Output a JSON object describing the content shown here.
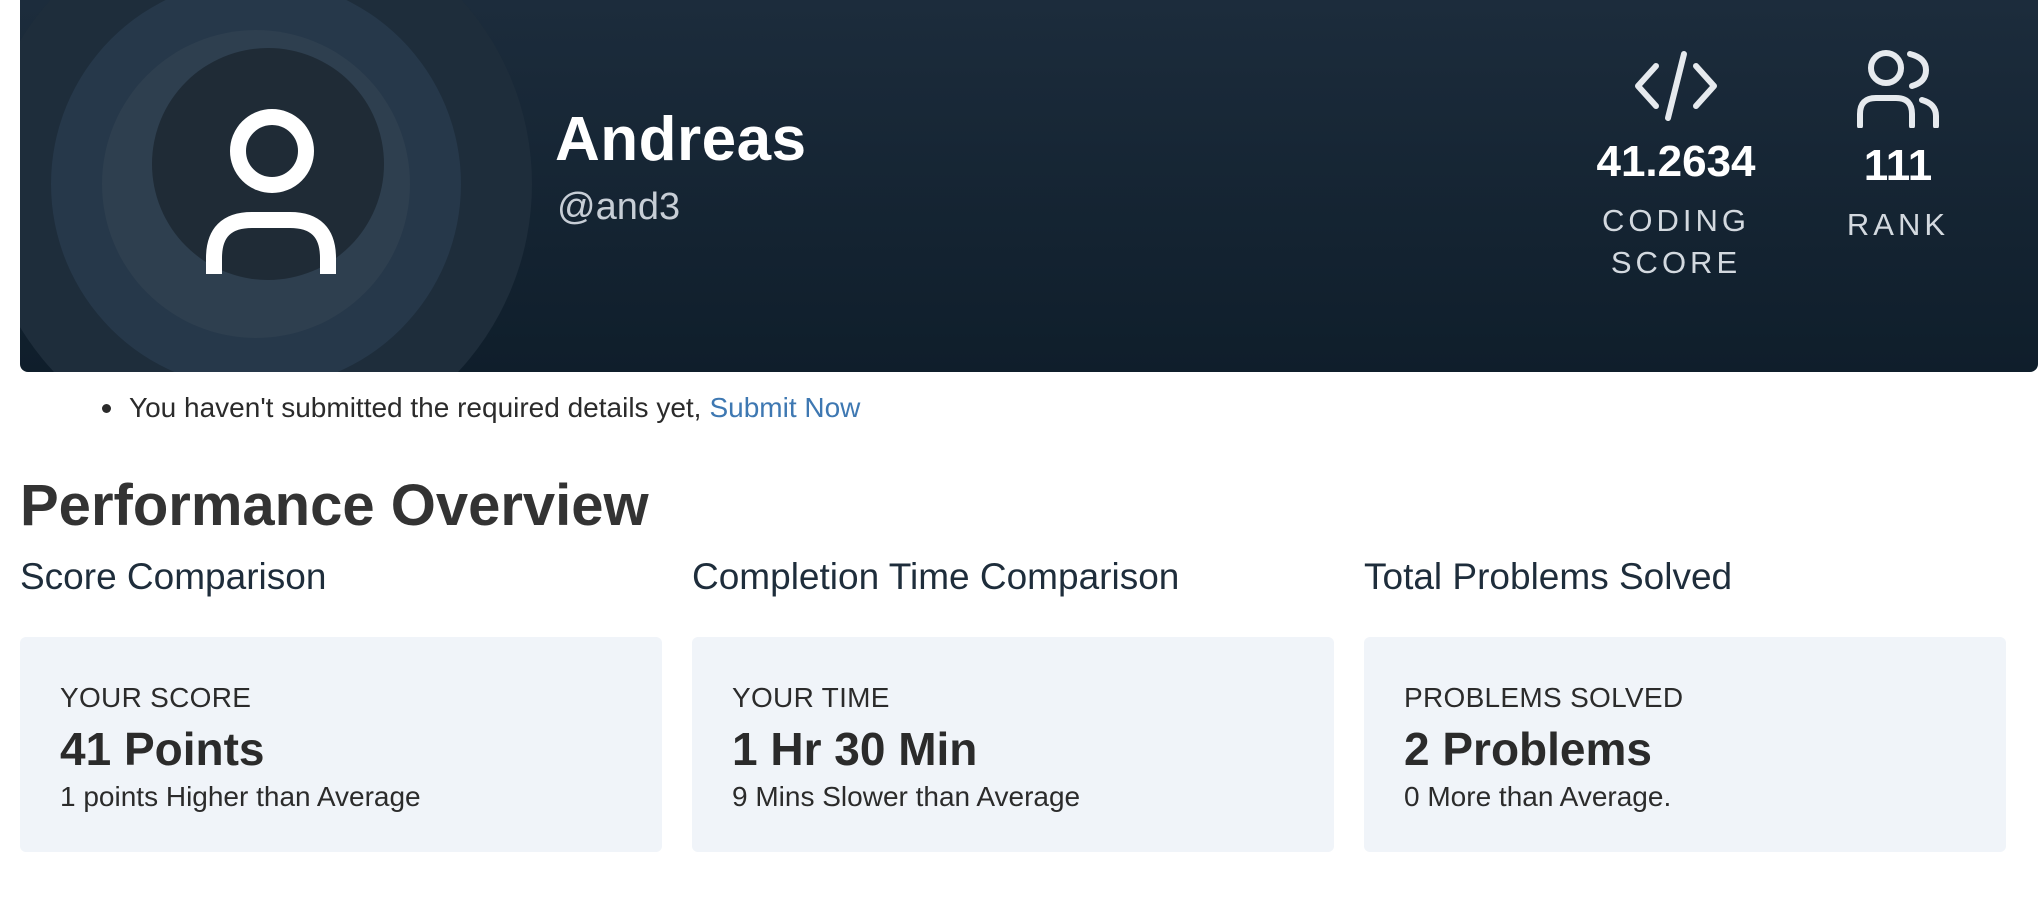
{
  "profile": {
    "name": "Andreas",
    "handle": "@and3",
    "avatar_icon": "user-icon",
    "stats": [
      {
        "icon": "code-icon",
        "value": "41.2634",
        "label": "CODING SCORE"
      },
      {
        "icon": "users-icon",
        "value": "111",
        "label": "RANK"
      }
    ]
  },
  "notice": {
    "text": "You haven't submitted the required details yet,",
    "link_label": "Submit Now"
  },
  "performance": {
    "title": "Performance Overview",
    "sections": [
      {
        "title": "Score Comparison",
        "label": "YOUR SCORE",
        "value": "41 Points",
        "detail": "1 points Higher than Average"
      },
      {
        "title": "Completion Time Comparison",
        "label": "YOUR TIME",
        "value": "1 Hr 30 Min",
        "detail": "9 Mins Slower than Average"
      },
      {
        "title": "Total Problems Solved",
        "label": "PROBLEMS SOLVED",
        "value": "2 Problems",
        "detail": "0 More than Average."
      }
    ]
  },
  "colors": {
    "banner_bg": "#132433",
    "link": "#3e78b2",
    "card_bg": "#f0f4f9"
  }
}
